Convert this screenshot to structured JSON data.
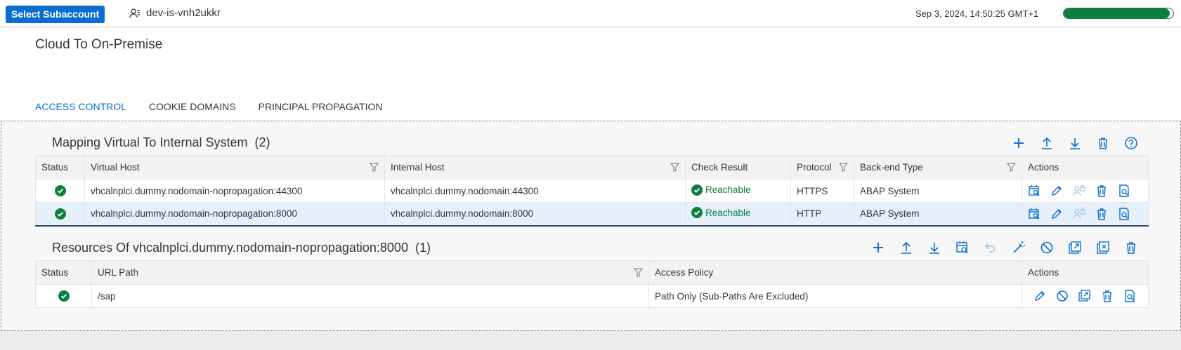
{
  "topbar": {
    "select_subaccount_label": "Select Subaccount",
    "subaccount_name": "dev-is-vnh2ukkr",
    "datetime": "Sep 3, 2024, 14:50:25 GMT+1",
    "progress_fraction": 0.97
  },
  "page": {
    "title": "Cloud To On-Premise",
    "tabs": [
      {
        "label": "ACCESS CONTROL",
        "active": true
      },
      {
        "label": "COOKIE DOMAINS",
        "active": false
      },
      {
        "label": "PRINCIPAL PROPAGATION",
        "active": false
      }
    ]
  },
  "mapping": {
    "title": "Mapping Virtual To Internal System",
    "count": "(2)",
    "toolbar": [
      "add-icon",
      "upload-icon",
      "download-icon",
      "delete-icon",
      "help-icon"
    ],
    "columns": [
      "Status",
      "Virtual Host",
      "Internal Host",
      "Check Result",
      "Protocol",
      "Back-end Type",
      "Actions"
    ],
    "rows": [
      {
        "virtual_host": "vhcalnplci.dummy.nodomain-nopropagation:44300",
        "internal_host": "vhcalnplci.dummy.nodomain:44300",
        "check_result": "Reachable",
        "protocol": "HTTPS",
        "backend_type": "ABAP System"
      },
      {
        "virtual_host": "vhcalnplci.dummy.nodomain-nopropagation:8000",
        "internal_host": "vhcalnplci.dummy.nodomain:8000",
        "check_result": "Reachable",
        "protocol": "HTTP",
        "backend_type": "ABAP System"
      }
    ]
  },
  "resources": {
    "title": "Resources Of vhcalnplci.dummy.nodomain-nopropagation:8000",
    "count": "(1)",
    "toolbar": [
      "add-icon",
      "upload-icon",
      "download-icon",
      "check-availability-icon",
      "undo-icon",
      "wand-icon",
      "disable-icon",
      "open-external-icon",
      "remove-window-icon",
      "delete-icon"
    ],
    "columns": [
      "Status",
      "URL Path",
      "Access Policy",
      "Actions"
    ],
    "rows": [
      {
        "url_path": "/sap",
        "access_policy": "Path Only (Sub-Paths Are Excluded)"
      }
    ]
  },
  "colors": {
    "accent": "#0a6ed1",
    "success": "#107e3e",
    "selected_row": "#e5f0fa"
  }
}
